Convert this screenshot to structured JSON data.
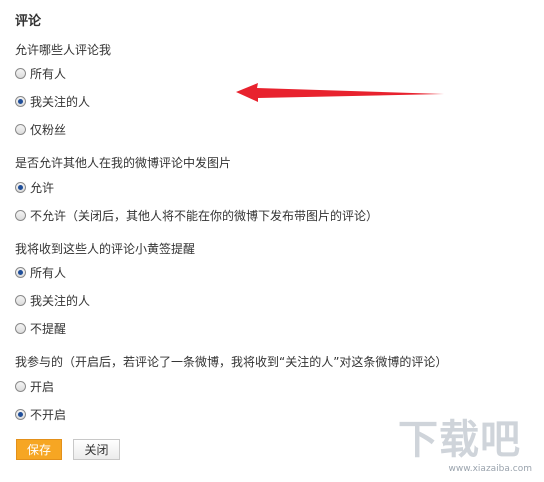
{
  "section": {
    "title": "评论"
  },
  "groups": [
    {
      "question": "允许哪些人评论我",
      "options": [
        {
          "label": "所有人",
          "checked": false
        },
        {
          "label": "我关注的人",
          "checked": true
        },
        {
          "label": "仅粉丝",
          "checked": false
        }
      ]
    },
    {
      "question": "是否允许其他人在我的微博评论中发图片",
      "options": [
        {
          "label": "允许",
          "checked": true
        },
        {
          "label": "不允许（关闭后，其他人将不能在你的微博下发布带图片的评论）",
          "checked": false
        }
      ]
    },
    {
      "question": "我将收到这些人的评论小黄签提醒",
      "options": [
        {
          "label": "所有人",
          "checked": true
        },
        {
          "label": "我关注的人",
          "checked": false
        },
        {
          "label": "不提醒",
          "checked": false
        }
      ]
    },
    {
      "question": "我参与的（开启后，若评论了一条微博，我将收到“关注的人”对这条微博的评论）",
      "options": [
        {
          "label": "开启",
          "checked": false
        },
        {
          "label": "不开启",
          "checked": true
        }
      ]
    }
  ],
  "buttons": {
    "save": "保存",
    "close": "关闭"
  },
  "watermark": {
    "logo": "下载吧",
    "url": "www.xiazaiba.com"
  },
  "colors": {
    "arrow": "#e8222e",
    "save_button": "#f6a623",
    "radio_checked": "#1f4e99"
  }
}
